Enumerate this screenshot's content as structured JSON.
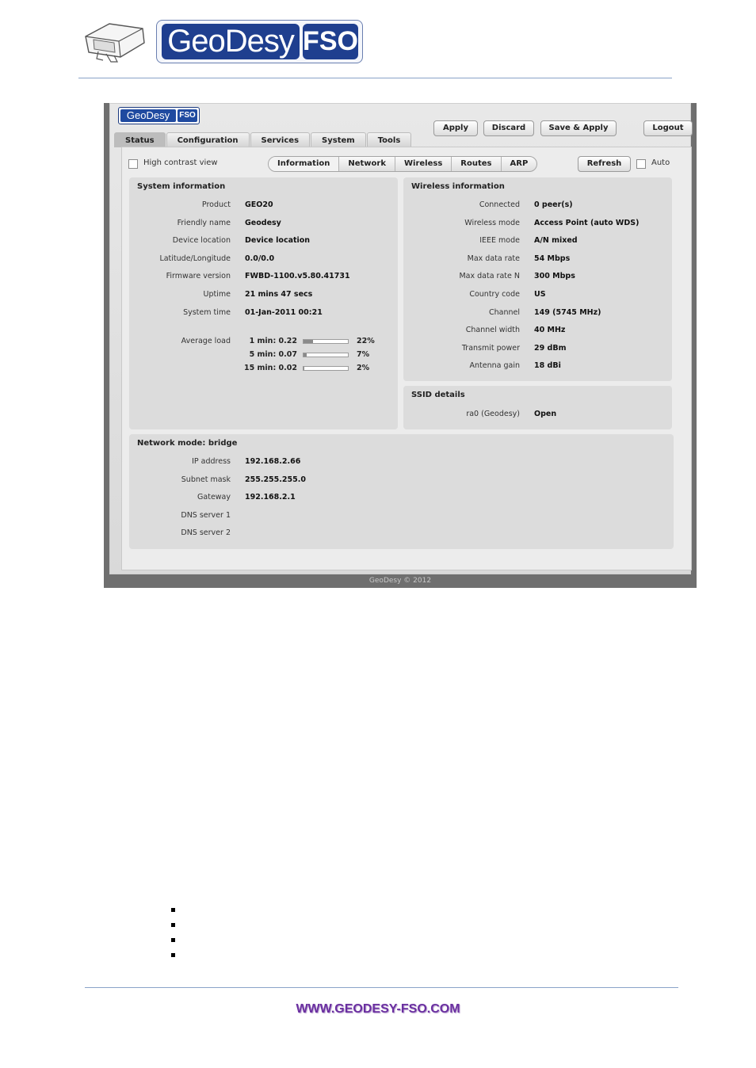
{
  "doc": {
    "logo_geodesy": "GeoDesy",
    "logo_fso": "FSO",
    "footer_link": "WWW.GEODESY-FSO.COM",
    "bullet_count": 4
  },
  "app": {
    "logo_geodesy": "GeoDesy",
    "logo_fso": "FSO",
    "buttons": {
      "apply": "Apply",
      "discard": "Discard",
      "save_apply": "Save & Apply",
      "logout": "Logout"
    },
    "tabs": [
      "Status",
      "Configuration",
      "Services",
      "System",
      "Tools"
    ],
    "active_tab": "Status",
    "high_contrast_label": "High contrast view",
    "high_contrast_checked": false,
    "subtabs": [
      "Information",
      "Network",
      "Wireless",
      "Routes",
      "ARP"
    ],
    "active_subtab": "Information",
    "refresh_label": "Refresh",
    "auto_label": "Auto",
    "auto_checked": false,
    "system_info": {
      "title": "System information",
      "rows": [
        {
          "key": "Product",
          "value": "GEO20"
        },
        {
          "key": "Friendly name",
          "value": "Geodesy"
        },
        {
          "key": "Device location",
          "value": "Device location"
        },
        {
          "key": "Latitude/Longitude",
          "value": "0.0/0.0"
        },
        {
          "key": "Firmware version",
          "value": "FWBD-1100.v5.80.41731"
        },
        {
          "key": "Uptime",
          "value": "21 mins 47 secs"
        },
        {
          "key": "System time",
          "value": "01-Jan-2011 00:21"
        }
      ],
      "avg_load_label": "Average load",
      "loads": [
        {
          "label": "1 min: 0.22",
          "percent": 22,
          "pct_text": "22%"
        },
        {
          "label": "5 min: 0.07",
          "percent": 7,
          "pct_text": "7%"
        },
        {
          "label": "15 min: 0.02",
          "percent": 2,
          "pct_text": "2%"
        }
      ]
    },
    "wireless_info": {
      "title": "Wireless information",
      "rows": [
        {
          "key": "Connected",
          "value": "0 peer(s)"
        },
        {
          "key": "Wireless mode",
          "value": "Access Point (auto WDS)"
        },
        {
          "key": "IEEE mode",
          "value": "A/N mixed"
        },
        {
          "key": "Max data rate",
          "value": "54 Mbps"
        },
        {
          "key": "Max data rate N",
          "value": "300 Mbps"
        },
        {
          "key": "Country code",
          "value": "US"
        },
        {
          "key": "Channel",
          "value": "149 (5745 MHz)"
        },
        {
          "key": "Channel width",
          "value": "40 MHz"
        },
        {
          "key": "Transmit power",
          "value": "29 dBm"
        },
        {
          "key": "Antenna gain",
          "value": "18 dBi"
        }
      ]
    },
    "ssid_details": {
      "title": "SSID details",
      "rows": [
        {
          "key": "ra0 (Geodesy)",
          "value": "Open"
        }
      ]
    },
    "network_mode": {
      "title": "Network mode: bridge",
      "rows": [
        {
          "key": "IP address",
          "value": "192.168.2.66"
        },
        {
          "key": "Subnet mask",
          "value": "255.255.255.0"
        },
        {
          "key": "Gateway",
          "value": "192.168.2.1"
        },
        {
          "key": "DNS server 1",
          "value": ""
        },
        {
          "key": "DNS server 2",
          "value": ""
        }
      ]
    },
    "copyright": "GeoDesy © 2012"
  }
}
